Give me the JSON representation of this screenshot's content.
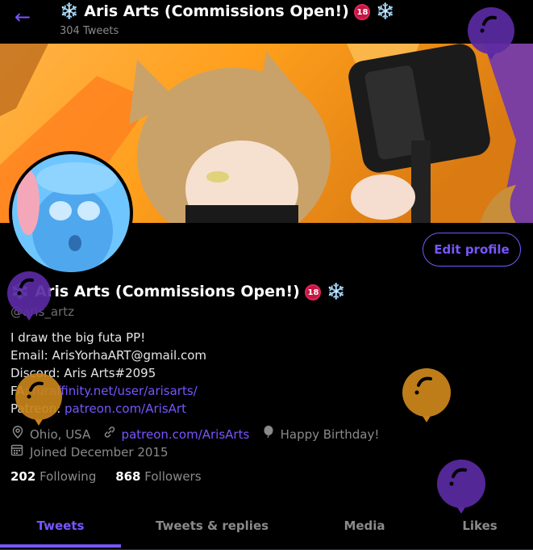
{
  "header": {
    "title": "Aris Arts (Commissions Open!)",
    "tweet_count": "304 Tweets"
  },
  "profile": {
    "name": "Aris Arts (Commissions Open!)",
    "handle": "@aris_artz",
    "edit_label": "Edit profile",
    "bio": {
      "line1": "I draw the big futa PP!",
      "line2": "Email: ArisYorhaART@gmail.com",
      "line3": "Discord: Aris Arts#2095",
      "fa_label": "FA:",
      "fa_link": "furaffinity.net/user/arisarts/",
      "patreon_label": "Patreon:",
      "patreon_link": "patreon.com/ArisArt"
    },
    "location": "Ohio, USA",
    "website": "patreon.com/ArisArts",
    "birthday": "Happy Birthday!",
    "joined": "Joined December 2015",
    "following_count": "202",
    "following_label": "Following",
    "followers_count": "868",
    "followers_label": "Followers",
    "badges": {
      "snowflake": "❄️",
      "age": "18"
    }
  },
  "tabs": [
    {
      "label": "Tweets",
      "active": true
    },
    {
      "label": "Tweets & replies",
      "active": false
    },
    {
      "label": "Media",
      "active": false
    },
    {
      "label": "Likes",
      "active": false
    }
  ],
  "colors": {
    "accent": "#7856ff",
    "balloon_purple": "#5b2aa3",
    "balloon_orange": "#c8841a"
  }
}
